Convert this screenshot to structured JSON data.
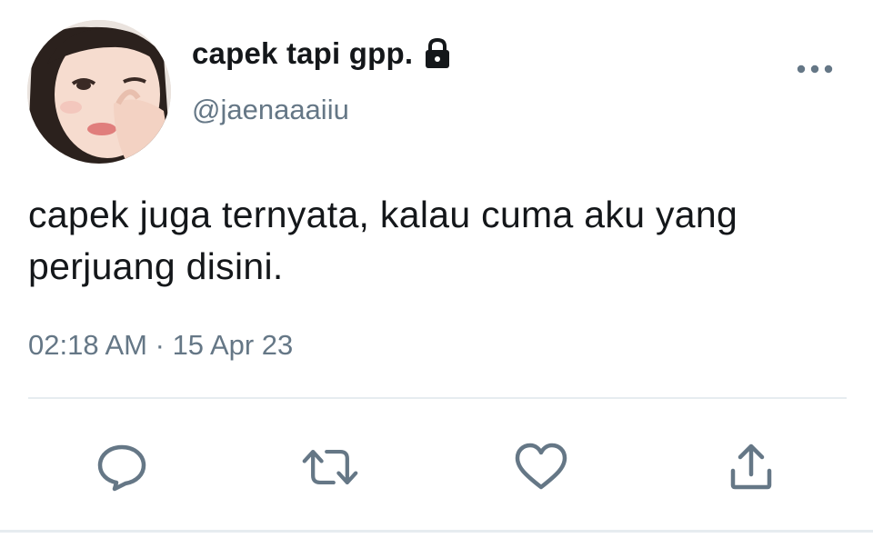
{
  "profile": {
    "display_name": "capek tapi gpp.",
    "handle": "@jaenaaaiiu",
    "protected_icon": "lock-icon"
  },
  "tweet": {
    "text": "capek juga ternyata, kalau cuma aku yang perjuang disini.",
    "time": "02:18 AM",
    "separator": "·",
    "date": "15 Apr 23"
  },
  "actions": {
    "reply_icon": "reply-icon",
    "retweet_icon": "retweet-icon",
    "like_icon": "heart-icon",
    "share_icon": "share-icon",
    "more_icon": "more-horizontal-icon"
  },
  "colors": {
    "text": "#14171a",
    "secondary": "#657786",
    "divider": "#e6ecf0"
  }
}
